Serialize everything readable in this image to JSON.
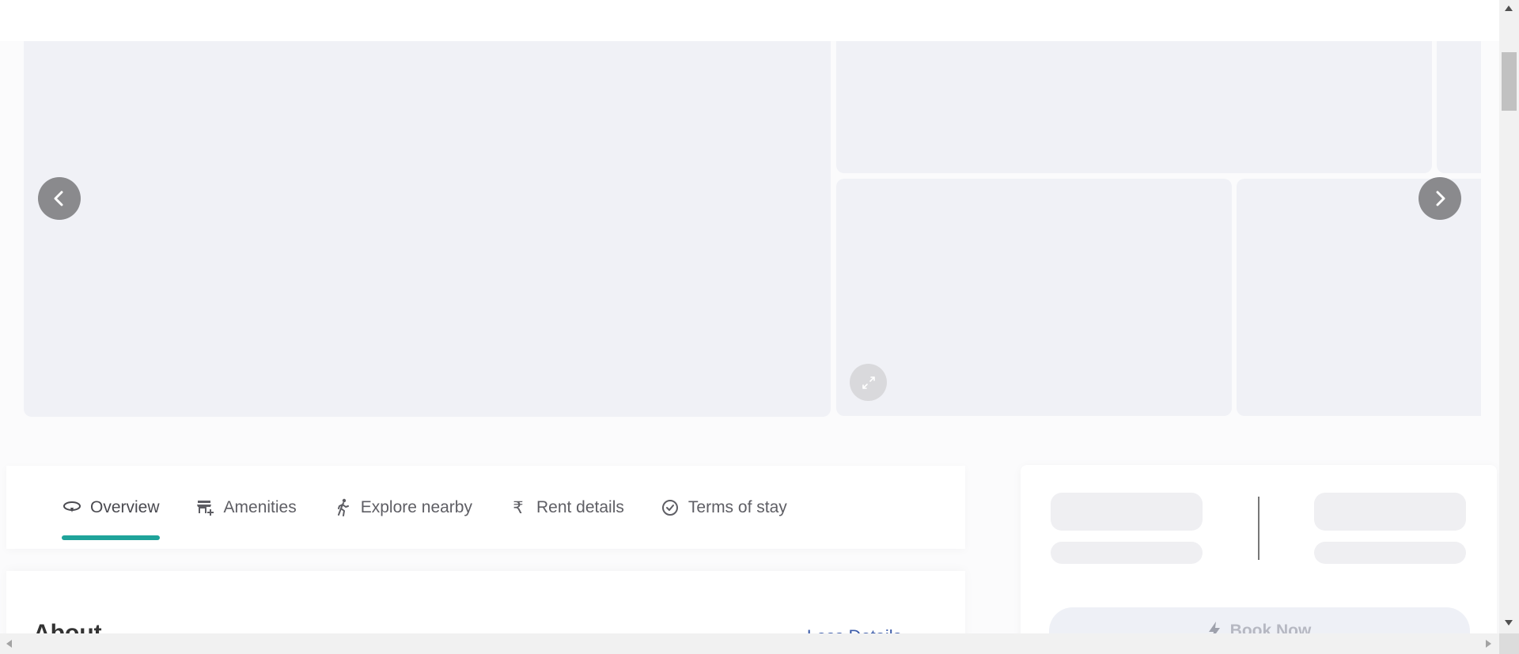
{
  "gallery": {
    "prev_icon": "chevron-left-icon",
    "next_icon": "chevron-right-icon",
    "expand_icon": "expand-arrows-icon"
  },
  "tabs": [
    {
      "label": "Overview",
      "icon": "eye-ring-icon",
      "active": true
    },
    {
      "label": "Amenities",
      "icon": "store-plus-icon",
      "active": false
    },
    {
      "label": "Explore nearby",
      "icon": "walking-person-icon",
      "active": false
    },
    {
      "label": "Rent details",
      "icon": "rupee-icon",
      "active": false
    },
    {
      "label": "Terms of stay",
      "icon": "check-circle-icon",
      "active": false
    }
  ],
  "colors": {
    "accent": "#1fa39a",
    "link": "#3b5ba9",
    "placeholder": "#f0f1f6"
  },
  "about": {
    "title": "About",
    "toggle_label": "Less Details"
  },
  "booking": {
    "book_label": "Book Now",
    "book_icon": "bolt-icon"
  }
}
